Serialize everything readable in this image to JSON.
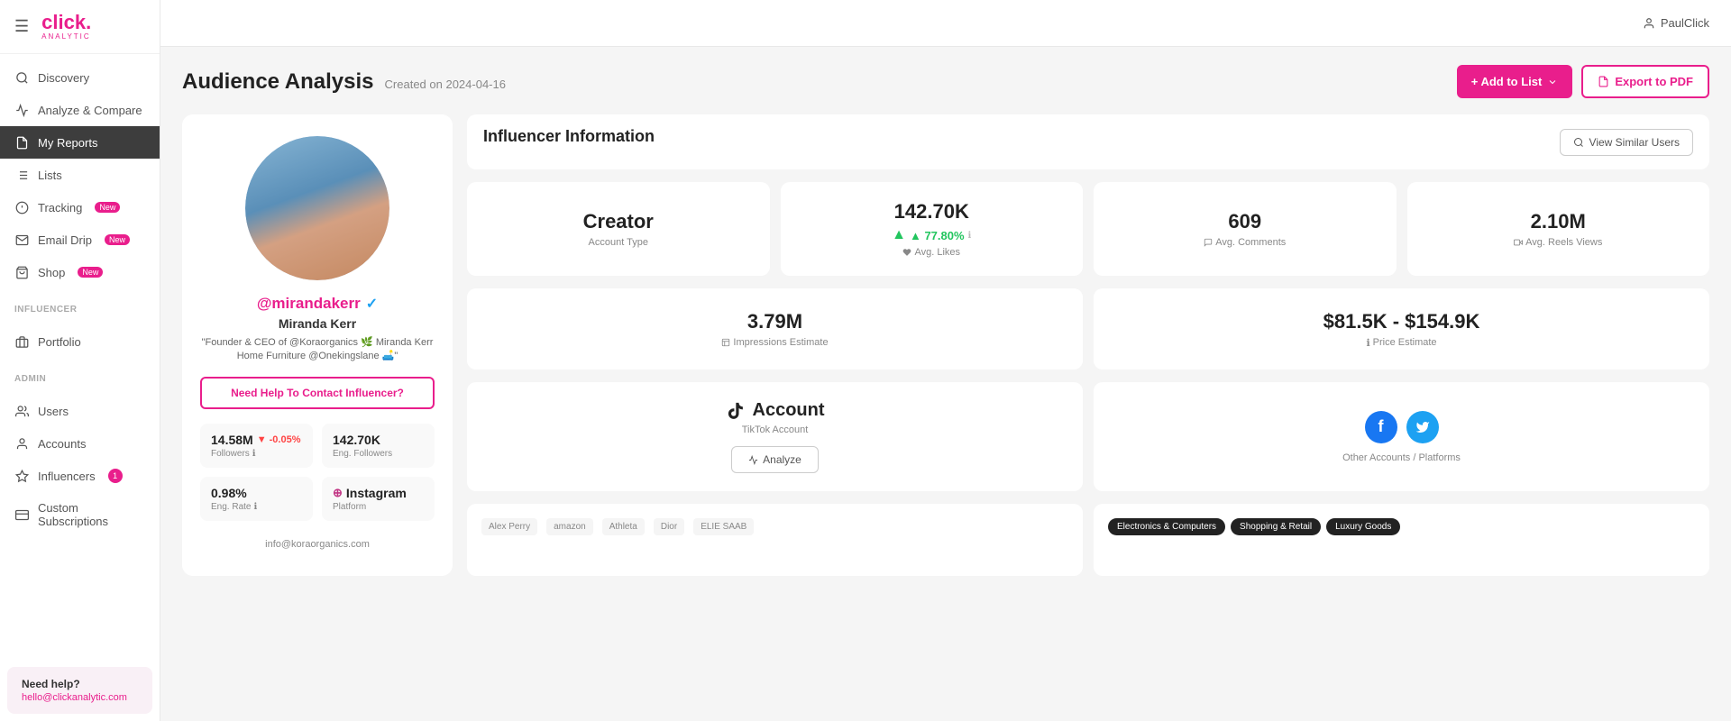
{
  "app": {
    "logo": "click.",
    "logo_sub": "ANALYTIC"
  },
  "topbar": {
    "user": "PaulClick"
  },
  "sidebar": {
    "nav_items": [
      {
        "id": "discovery",
        "label": "Discovery",
        "icon": "search"
      },
      {
        "id": "analyze",
        "label": "Analyze & Compare",
        "icon": "chart"
      },
      {
        "id": "my-reports",
        "label": "My Reports",
        "icon": "document",
        "active": true
      },
      {
        "id": "lists",
        "label": "Lists",
        "icon": "list"
      },
      {
        "id": "tracking",
        "label": "Tracking",
        "icon": "tracking",
        "badge": "New"
      },
      {
        "id": "email-drip",
        "label": "Email Drip",
        "icon": "email",
        "badge": "New"
      },
      {
        "id": "shop",
        "label": "Shop",
        "icon": "shop",
        "badge": "New"
      }
    ],
    "influencer_section": "INFLUENCER",
    "influencer_items": [
      {
        "id": "portfolio",
        "label": "Portfolio",
        "icon": "portfolio"
      }
    ],
    "admin_section": "ADMIN",
    "admin_items": [
      {
        "id": "users",
        "label": "Users",
        "icon": "users"
      },
      {
        "id": "accounts",
        "label": "Accounts",
        "icon": "accounts"
      },
      {
        "id": "influencers",
        "label": "Influencers",
        "icon": "influencers",
        "badge_count": "1"
      },
      {
        "id": "custom-subs",
        "label": "Custom Subscriptions",
        "icon": "subs"
      }
    ],
    "need_help": "Need help?",
    "help_email": "hello@clickanalytic.com"
  },
  "page": {
    "title": "Audience Analysis",
    "subtitle": "Created on 2024-04-16",
    "btn_add_list": "+ Add to List",
    "btn_export": "Export to PDF"
  },
  "influencer": {
    "username": "@mirandakerr",
    "display_name": "Miranda Kerr",
    "bio": "\"Founder & CEO of @Koraorganics 🌿 Miranda Kerr Home Furniture @Onekingslane 🛋️\"",
    "contact_btn": "Need Help To Contact Influencer?",
    "followers": "14.58M",
    "followers_change": "▼ -0.05%",
    "eng_followers": "142.70K",
    "eng_rate": "0.98%",
    "platform": "Instagram",
    "email": "info@koraorganics.com"
  },
  "info_section": {
    "title": "Influencer Information",
    "view_similar": "View Similar Users",
    "cards": [
      {
        "value": "Creator",
        "label": "Account Type"
      },
      {
        "value": "142.70K",
        "pct": "▲ 77.80%",
        "sublabel": "Avg. Likes"
      },
      {
        "value": "609",
        "label": "Avg. Comments"
      },
      {
        "value": "2.10M",
        "label": "Avg. Reels Views"
      }
    ],
    "card2": [
      {
        "value": "3.79M",
        "label": "Impressions Estimate"
      },
      {
        "value": "$81.5K - $154.9K",
        "label": "Price Estimate"
      }
    ]
  },
  "accounts": {
    "tiktok_label": "Account",
    "tiktok_sub": "TikTok Account",
    "tiktok_btn": "Analyze",
    "other_label": "Other Accounts / Platforms"
  },
  "brands": {
    "chips": [
      "Electronics & Computers",
      "Shopping & Retail",
      "Luxury Goods"
    ],
    "logo_labels": [
      "Alex Perry",
      "Amazon",
      "Athleta",
      "Christian Dior",
      "ELIE SAAB"
    ]
  }
}
